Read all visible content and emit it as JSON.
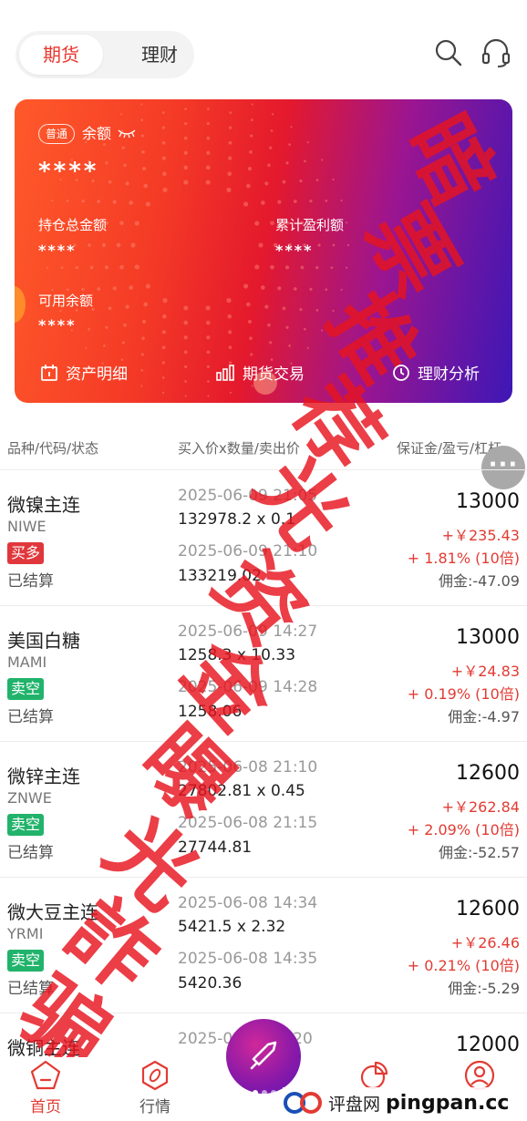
{
  "header": {
    "tabs": [
      {
        "label": "期货",
        "active": true
      },
      {
        "label": "理财",
        "active": false
      }
    ],
    "icons": [
      "search-icon",
      "headset-icon"
    ]
  },
  "card": {
    "badge": "普通",
    "balance_label": "余额",
    "balance_value": "****",
    "position_label": "持仓总金额",
    "position_value": "****",
    "profit_label": "累计盈利额",
    "profit_value": "****",
    "available_label": "可用余额",
    "available_value": "****",
    "links": [
      {
        "label": "资产明细",
        "icon": "calendar-icon"
      },
      {
        "label": "期货交易",
        "icon": "bar-chart-icon"
      },
      {
        "label": "理财分析",
        "icon": "clock-icon"
      }
    ]
  },
  "table": {
    "headers": [
      "品种/代码/状态",
      "买入价x数量/卖出价",
      "保证金/盈亏/杠杆"
    ],
    "rows": [
      {
        "name": "微镍主连",
        "code": "NIWE",
        "direction": "买多",
        "dir_color": "#e0373c",
        "state": "已结算",
        "open_time": "2025-06-09 21:05",
        "open_price_qty": "132978.2 x 0.1",
        "close_time": "2025-06-09 21:10",
        "close_price": "133219.02",
        "margin": "13000",
        "pl": "+￥235.43",
        "pct": "+ 1.81% (10倍)",
        "commission": "佣金:-47.09"
      },
      {
        "name": "美国白糖",
        "code": "MAMI",
        "direction": "卖空",
        "dir_color": "#21b36b",
        "state": "已结算",
        "open_time": "2025-06-09 14:27",
        "open_price_qty": "1258.3 x 10.33",
        "close_time": "2025-06-09 14:28",
        "close_price": "1258.06",
        "margin": "13000",
        "pl": "+￥24.83",
        "pct": "+ 0.19% (10倍)",
        "commission": "佣金:-4.97"
      },
      {
        "name": "微锌主连",
        "code": "ZNWE",
        "direction": "卖空",
        "dir_color": "#21b36b",
        "state": "已结算",
        "open_time": "2025-06-08 21:10",
        "open_price_qty": "27802.81 x 0.45",
        "close_time": "2025-06-08 21:15",
        "close_price": "27744.81",
        "margin": "12600",
        "pl": "+￥262.84",
        "pct": "+ 2.09% (10倍)",
        "commission": "佣金:-52.57"
      },
      {
        "name": "微大豆主连",
        "code": "YRMI",
        "direction": "卖空",
        "dir_color": "#21b36b",
        "state": "已结算",
        "open_time": "2025-06-08 14:34",
        "open_price_qty": "5421.5 x 2.32",
        "close_time": "2025-06-08 14:35",
        "close_price": "5420.36",
        "margin": "12600",
        "pl": "+￥26.46",
        "pct": "+ 0.21% (10倍)",
        "commission": "佣金:-5.29"
      },
      {
        "name": "微铜主连",
        "code": "",
        "direction": "",
        "dir_color": "#21b36b",
        "state": "",
        "open_time": "2025-06-08 ...:20",
        "open_price_qty": "",
        "close_time": "",
        "close_price": "",
        "margin": "12000",
        "pl": "",
        "pct": "",
        "commission": ""
      }
    ]
  },
  "watermark": {
    "text": [
      "暗",
      "票",
      "推",
      "荐",
      "光",
      "资",
      "金",
      "曝",
      "光",
      "詐",
      "骗"
    ],
    "color": "#e6141e"
  },
  "nav": {
    "items": [
      {
        "label": "首页"
      },
      {
        "label": "行情"
      },
      {
        "label": ""
      },
      {
        "label": ""
      }
    ],
    "brand_cn": "评盘网",
    "brand_en": "pingpan.cc"
  }
}
